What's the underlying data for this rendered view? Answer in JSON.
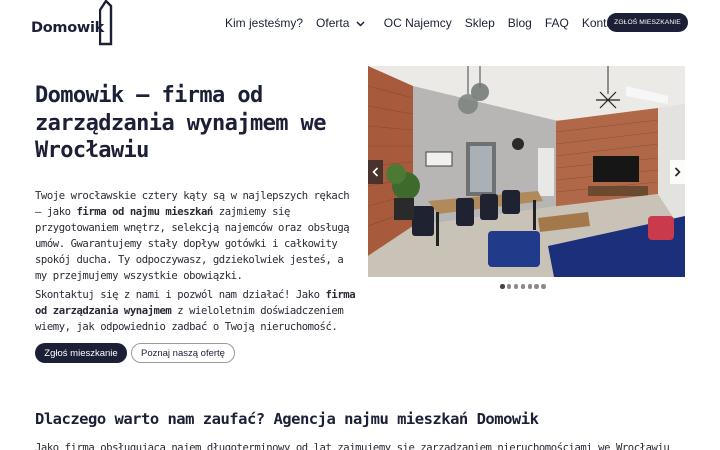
{
  "brand": {
    "name": "Domowik"
  },
  "nav": {
    "items": [
      {
        "label": "Kim jesteśmy?"
      },
      {
        "label": "Oferta"
      },
      {
        "label": "OC Najemcy"
      },
      {
        "label": "Sklep"
      },
      {
        "label": "Blog"
      },
      {
        "label": "FAQ"
      },
      {
        "label": "Kontakt"
      }
    ],
    "cta": "ZGŁOŚ MIESZKANIE"
  },
  "hero": {
    "title_lines": [
      "Domowik – firma od",
      "zarządzania wynajmem we",
      "Wrocławiu"
    ],
    "p1": {
      "a": "Twoje wrocławskie cztery kąty są w najlepszych rękach – jako ",
      "b": "firma od najmu mieszkań",
      "c": " zajmiemy się przygotowaniem wnętrz, selekcją najemców oraz obsługą umów. Gwarantujemy stały dopływ gotówki i całkowity spokój ducha. Ty odpoczywasz, gdziekolwiek jesteś, a my przejmujemy wszystkie obowiązki."
    },
    "p2": {
      "a": "Skontaktuj się z nami i pozwól nam działać! Jako ",
      "b": "firma od zarządzania wynajmem",
      "c": " z wieloletnim doświadczeniem wiemy, jak odpowiednio zadbać o Twoją nieruchomość."
    },
    "btn_primary": "Zgłoś mieszkanie",
    "btn_secondary": "Poznaj naszą ofertę"
  },
  "slider": {
    "slide_count": 7,
    "active_index": 0
  },
  "section2": {
    "title": "Dlaczego warto nam zaufać? Agencja najmu mieszkań Domowik",
    "text": "Jako firma obsługująca najem długoterminowy od lat zajmujemy się zarządzaniem nieruchomościami we Wrocławiu"
  },
  "colors": {
    "navy": "#1c2036"
  }
}
